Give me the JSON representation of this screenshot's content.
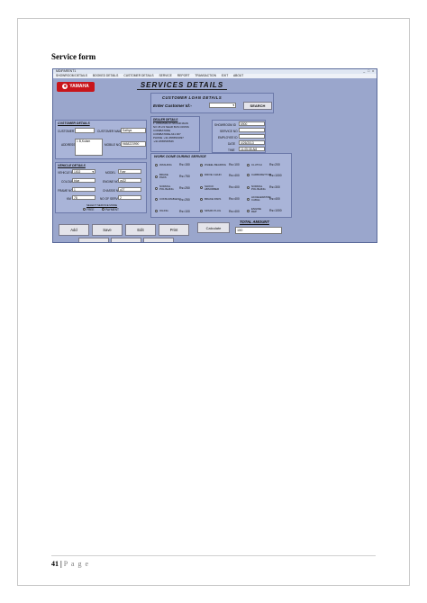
{
  "document": {
    "heading": "Service form",
    "page_number": "41",
    "page_sep": "|",
    "page_label": "P a g e"
  },
  "app": {
    "window_title": "MDIPARENT1",
    "window_controls": "_ □ x",
    "menu": [
      "SHOWROOM DETAILS",
      "BOOKED DETAILS",
      "CUSTOMER DETAILS",
      "SERVICE",
      "REPORT",
      "TRANSACTION",
      "EXIT",
      "ABOUT"
    ],
    "logo_text": "YAMAHA",
    "title": "SERVICES  DETAILS",
    "loan_header": "CUSTOMER   LOAN   DETAILS",
    "customer_id_label": "Enter Customer Id:-",
    "search_button": "SEARCH",
    "customer_details": {
      "title": "CUSTOMER DETAILS",
      "customer_id_label": "CUSTOMER ID",
      "customer_id_value": "",
      "customer_name_label": "CUSTOMER NAME",
      "customer_name_value": "Sathya",
      "address_label": "ADDRESS",
      "address_value": "1 B,Kulam",
      "mobile_label": "MOBILE NO",
      "mobile_value": "9658223990"
    },
    "dealer": {
      "title": "DEALER DETAILS",
      "lines": [
        "1. ANNAMALAI NAGAR MAIN",
        "NO 45 2/2 NEAR BUS CROSS",
        "COIMBATORE",
        "COIMBATORE-641 007",
        "PHONE  :+91-9565543097",
        "         :+91-9565545546"
      ]
    },
    "service_info": {
      "showroom_label": "SHOWROOM ID",
      "showroom_value": "6900",
      "service_no_label": "SERVICE NO",
      "service_no_value": "",
      "employee_label": "EMPLOYEE ID",
      "employee_value": "",
      "date_label": "DATE",
      "date_value": "4/26/2013",
      "time_label": "TIME",
      "time_value": "11:05:08 AM"
    },
    "vehicle": {
      "title": "VEHICLE DETAILS",
      "vehicle_id_label": "VEHICLE ID",
      "vehicle_id_value": "1002",
      "model_label": "MODEL",
      "model_value": "Fzer",
      "colour_label": "COLOUR",
      "colour_value": "blue",
      "engine_no_label": "ENGINE NO",
      "engine_no_value": "ys32",
      "frame_label": "FRAME NO",
      "frame_value": "1",
      "chassis_label": "CHASSIS NO",
      "chassis_value": "y27",
      "km_label": "KM",
      "km_value": "78",
      "service_count_label": "NO OF SERVICE",
      "service_count_value": "2",
      "service_mode_title": "SELECT SERVICE MODE",
      "mode_free": "FREE",
      "mode_payment": "PAYMENT"
    },
    "work": {
      "title": "WORK  DONE  DURING  SERVICE",
      "items": [
        {
          "label": "WASHING",
          "price": "Rs=150"
        },
        {
          "label": "WHEEL BEARING",
          "price": "Rs=100"
        },
        {
          "label": "CLUTCH",
          "price": "Rs=200"
        },
        {
          "label": "BRAKE PADS",
          "price": "Rs=750"
        },
        {
          "label": "DRIVE CHAIN",
          "price": "Rs=400"
        },
        {
          "label": "CARBURETTOR",
          "price": "Rs=1000"
        },
        {
          "label": "NORMAL POLISHING",
          "price": "Rs=250"
        },
        {
          "label": "SHOCK ABSORBER",
          "price": "Rs=400"
        },
        {
          "label": "NORMAL POLISHING",
          "price": "Rs=300"
        },
        {
          "label": "CONSUMABLES",
          "price": "Rs=250"
        },
        {
          "label": "BRAKE PADS",
          "price": "Rs=400"
        },
        {
          "label": "ACCELERATOR CABLE",
          "price": "Rs=400"
        },
        {
          "label": "OILING",
          "price": "Rs=100"
        },
        {
          "label": "SPARK PLUG",
          "price": "Rs=400"
        },
        {
          "label": "ENGINE REP",
          "price": "Rs=1000"
        }
      ]
    },
    "total": {
      "label": "TOTAL AMOUNT",
      "value": "150"
    },
    "buttons": {
      "add": "Add",
      "save": "Save",
      "edit": "Edit",
      "print": "Print",
      "calculate": "Calculate"
    }
  }
}
